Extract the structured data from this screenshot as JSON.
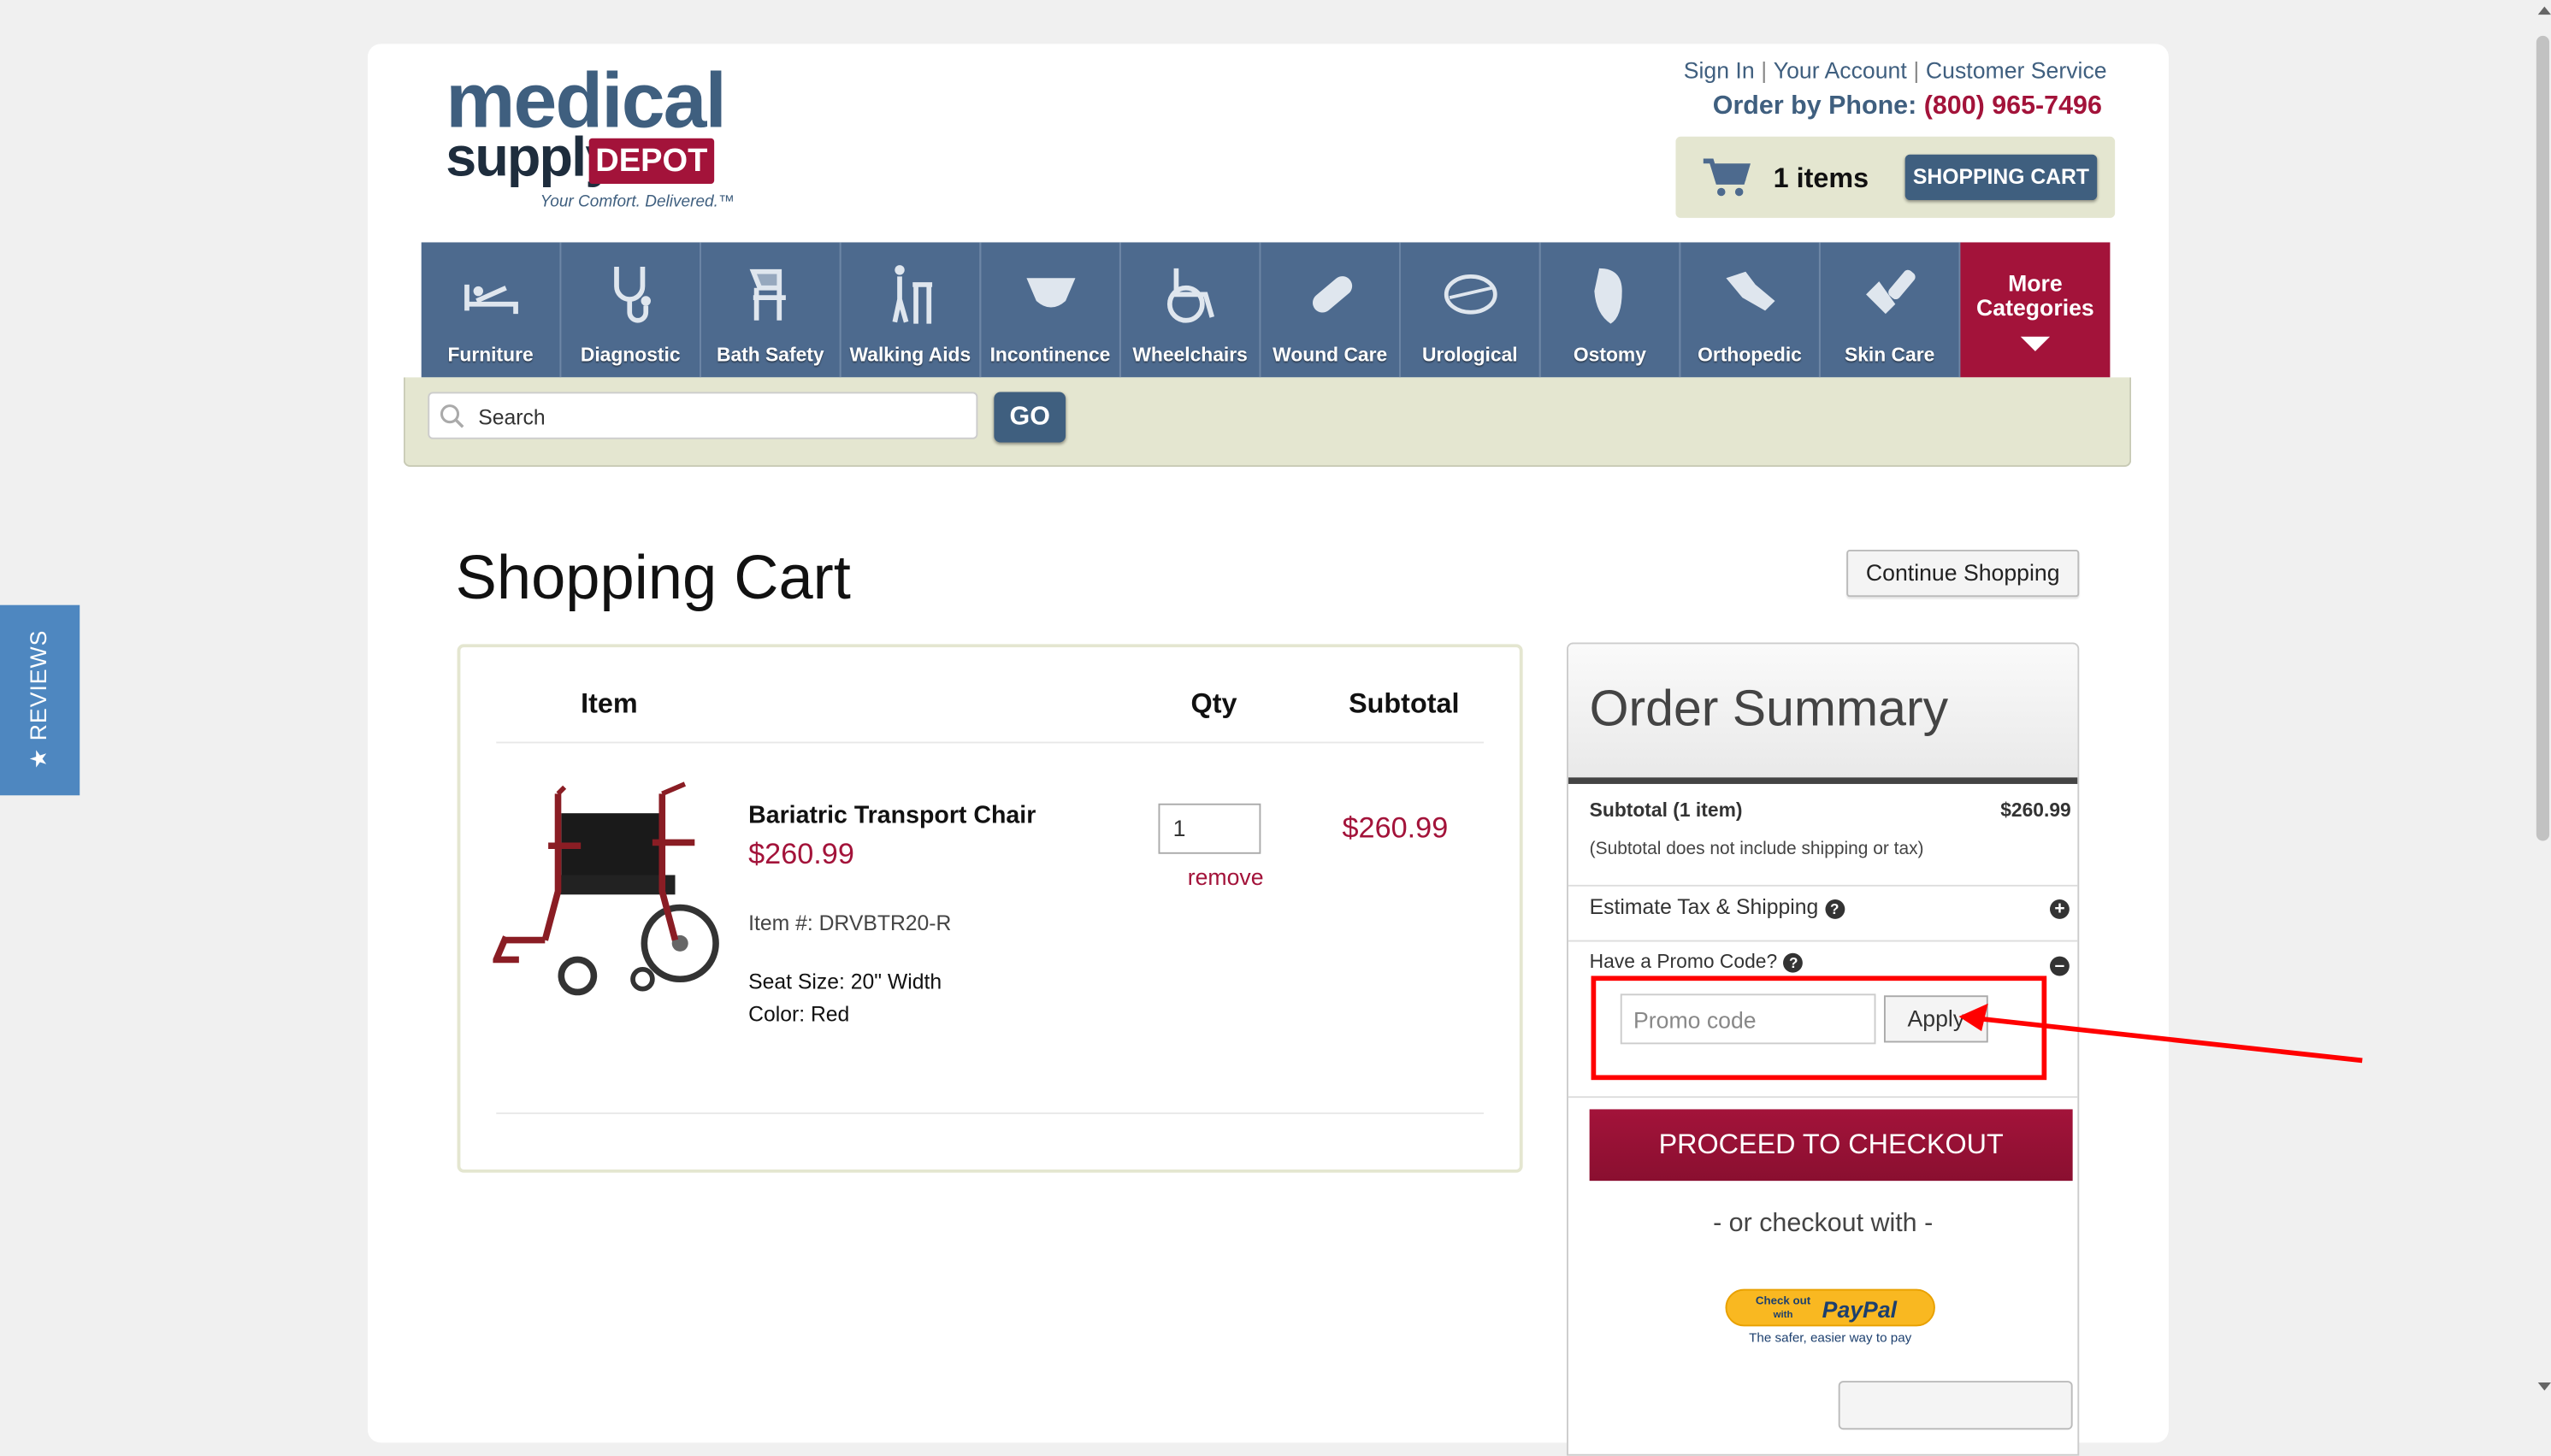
{
  "logo": {
    "word1": "medical",
    "word2": "supply",
    "word3": "DEPOT",
    "tagline": "Your Comfort. Delivered.™"
  },
  "header": {
    "links": [
      "Sign In",
      "Your Account",
      "Customer Service"
    ],
    "separator": "|",
    "phone_label": "Order by Phone:",
    "phone_number": "(800) 965-7496"
  },
  "cart_widget": {
    "count": "1 items",
    "button": "SHOPPING CART"
  },
  "nav": {
    "items": [
      {
        "label": "Furniture",
        "icon": "bed-icon"
      },
      {
        "label": "Diagnostic",
        "icon": "stethoscope-icon"
      },
      {
        "label": "Bath Safety",
        "icon": "bath-chair-icon"
      },
      {
        "label": "Walking Aids",
        "icon": "walker-icon"
      },
      {
        "label": "Incontinence",
        "icon": "brief-icon"
      },
      {
        "label": "Wheelchairs",
        "icon": "wheelchair-icon"
      },
      {
        "label": "Wound Care",
        "icon": "bandage-icon"
      },
      {
        "label": "Urological",
        "icon": "catheter-icon"
      },
      {
        "label": "Ostomy",
        "icon": "ostomy-bag-icon"
      },
      {
        "label": "Orthopedic",
        "icon": "wrist-brace-icon"
      },
      {
        "label": "Skin Care",
        "icon": "lotion-icon"
      }
    ],
    "more_line1": "More",
    "more_line2": "Categories"
  },
  "search": {
    "placeholder": "Search",
    "button": "GO"
  },
  "page": {
    "title": "Shopping Cart",
    "continue_button": "Continue Shopping"
  },
  "cart": {
    "columns": {
      "item": "Item",
      "qty": "Qty",
      "subtotal": "Subtotal"
    },
    "items": [
      {
        "name": "Bariatric Transport Chair",
        "price": "$260.99",
        "item_number": "Item #: DRVBTR20-R",
        "seat_size": "Seat Size: 20\" Width",
        "color": "Color: Red",
        "qty": "1",
        "remove": "remove",
        "subtotal": "$260.99"
      }
    ]
  },
  "summary": {
    "title": "Order Summary",
    "subtotal_label": "Subtotal (1 item)",
    "subtotal_value": "$260.99",
    "subtotal_note": "(Subtotal does not include shipping or tax)",
    "estimate_label": "Estimate Tax & Shipping",
    "promo_label": "Have a Promo Code?",
    "promo_placeholder": "Promo code",
    "apply_button": "Apply",
    "checkout_button": "PROCEED TO CHECKOUT",
    "or_with": "- or checkout with -",
    "paypal_line1": "Check out",
    "paypal_line2": "with",
    "paypal_brand": "PayPal",
    "paypal_tag": "The safer, easier way to pay"
  },
  "reviews_tab": "★ REVIEWS",
  "colors": {
    "brand_blue": "#3f5f7f",
    "brand_red": "#a3133a",
    "annotation_red": "#ff0000"
  }
}
